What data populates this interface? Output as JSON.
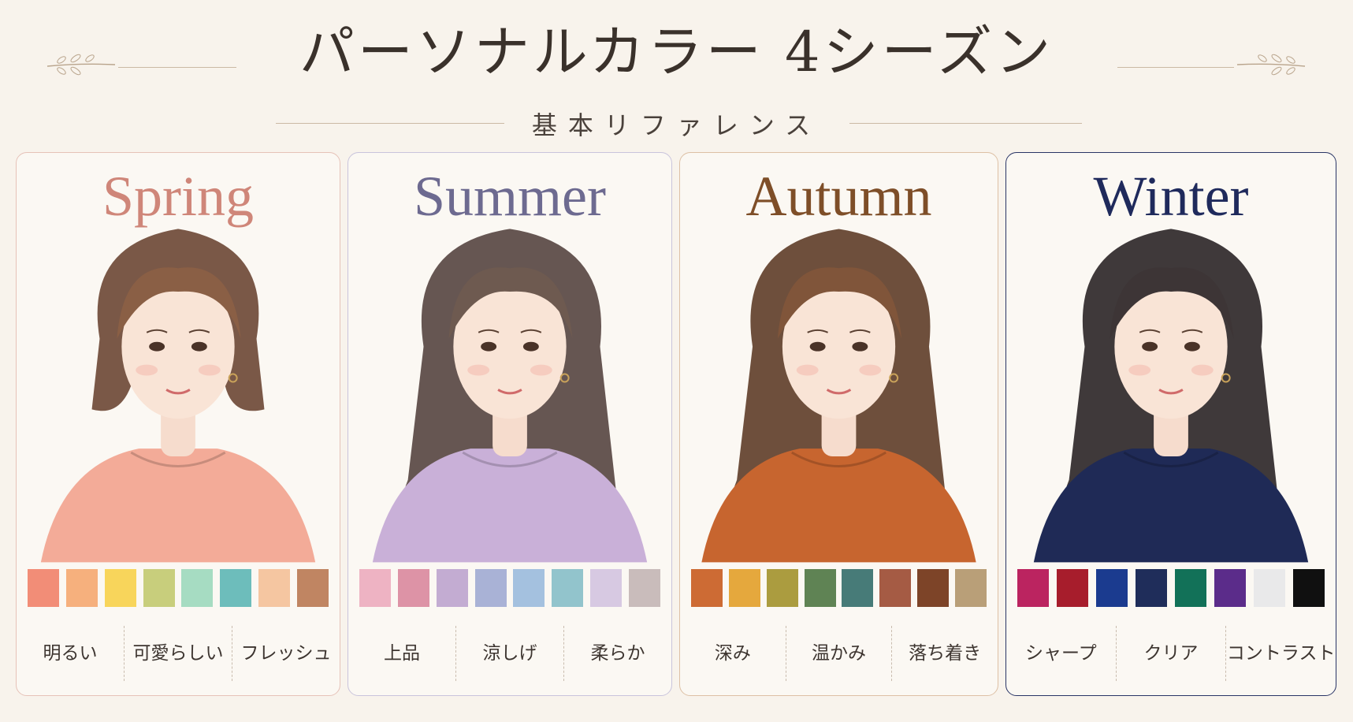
{
  "header": {
    "title": "パーソナルカラー 4シーズン",
    "subtitle": "基本リファレンス"
  },
  "seasons": [
    {
      "name": "Spring",
      "title_color": "#cf8679",
      "border_color": "#e6c2b8",
      "hair_color": "#8a5f45",
      "hair_dark": "#6b4634",
      "top_color": "#f3ab98",
      "swatches": [
        "#f28d77",
        "#f6b07d",
        "#f8d55b",
        "#c8ce7c",
        "#a6dcc2",
        "#6dbdbb",
        "#f5c6a1",
        "#c08562"
      ],
      "keywords": [
        "明るい",
        "可愛らしい",
        "フレッシュ"
      ]
    },
    {
      "name": "Summer",
      "title_color": "#6d6a90",
      "border_color": "#c9c4dc",
      "hair_color": "#6e5a50",
      "hair_dark": "#554440",
      "top_color": "#c9b0d8",
      "swatches": [
        "#eeb3c3",
        "#dd93a6",
        "#c3acd2",
        "#a9b2d6",
        "#a4c1df",
        "#92c4cc",
        "#d7c9e2",
        "#c9bcbb"
      ],
      "keywords": [
        "上品",
        "涼しげ",
        "柔らか"
      ]
    },
    {
      "name": "Autumn",
      "title_color": "#7e4e28",
      "border_color": "#ddc0a5",
      "hair_color": "#80553a",
      "hair_dark": "#5e3c28",
      "top_color": "#c7652f",
      "swatches": [
        "#cd6b34",
        "#e5a83d",
        "#ab9c3f",
        "#5f8354",
        "#477b78",
        "#a55b44",
        "#7d4428",
        "#b99f78"
      ],
      "keywords": [
        "深み",
        "温かみ",
        "落ち着き"
      ]
    },
    {
      "name": "Winter",
      "title_color": "#1f2a5c",
      "border_color": "#2a3566",
      "hair_color": "#3d3536",
      "hair_dark": "#2a2426",
      "top_color": "#1f2a56",
      "swatches": [
        "#bb2460",
        "#a71d2c",
        "#1b3b8f",
        "#1f2d5a",
        "#127158",
        "#5b2c8a",
        "#e9e9ea",
        "#101010"
      ],
      "keywords": [
        "シャープ",
        "クリア",
        "コントラスト"
      ]
    }
  ]
}
